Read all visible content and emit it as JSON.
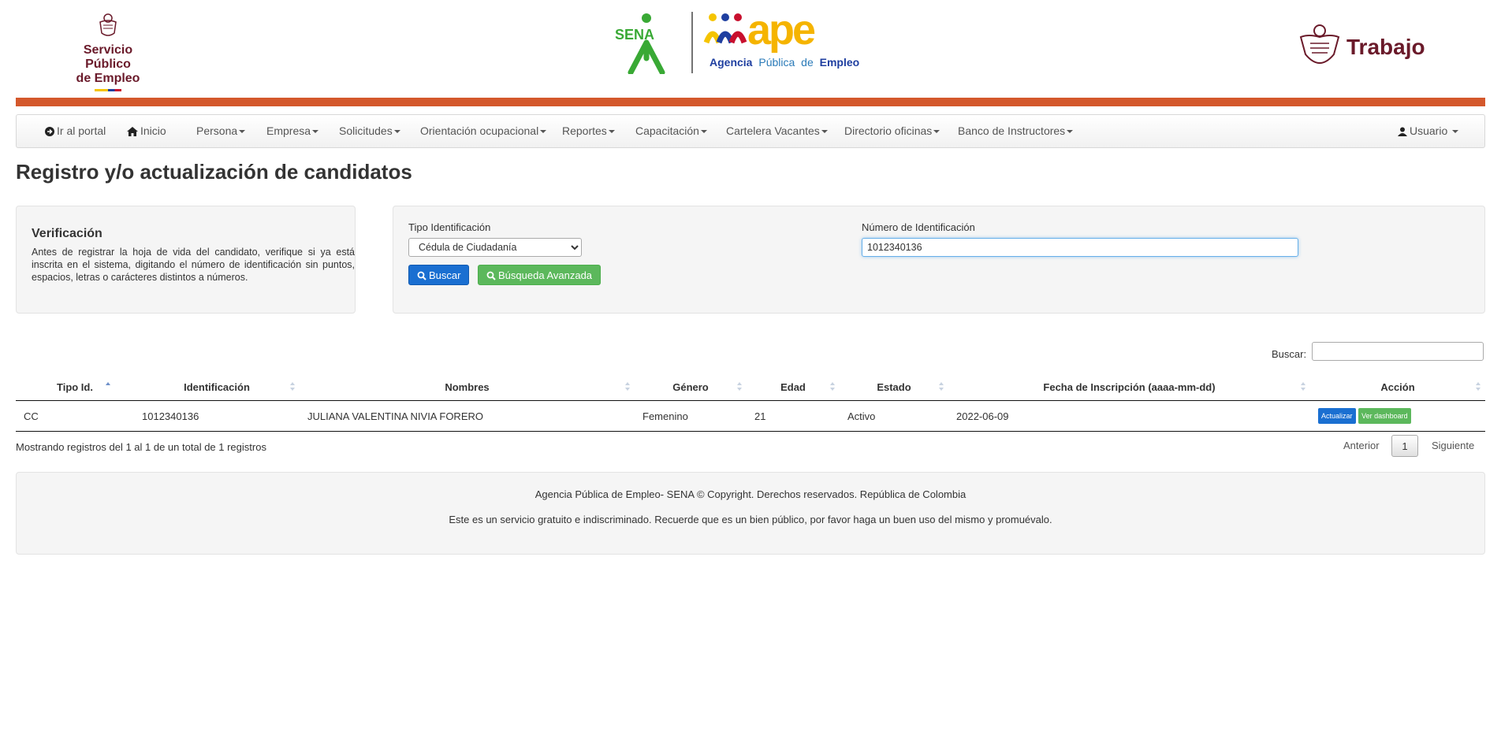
{
  "header": {
    "spe_logo": {
      "line1": "Servicio Público",
      "line2": "de Empleo"
    },
    "sena_label": "SENA",
    "ape_label": "ape",
    "ape_sub": {
      "a": "Agencia",
      "b": "Pública",
      "c": "de",
      "d": "Empleo"
    },
    "trabajo_label": "Trabajo",
    "accent_color": "#d4582c"
  },
  "nav": {
    "portal": "Ir al portal",
    "inicio": "Inicio",
    "items": [
      "Persona",
      "Empresa",
      "Solicitudes",
      "Orientación ocupacional",
      "Reportes",
      "Capacitación",
      "Cartelera Vacantes",
      "Directorio oficinas",
      "Banco de Instructores"
    ],
    "user": "Usuario"
  },
  "page_title": "Registro y/o actualización de candidatos",
  "verification": {
    "title": "Verificación",
    "text": "Antes de registrar la hoja de vida del candidato, verifique si ya está inscrita en el sistema, digitando el número de identificación sin puntos, espacios, letras o carácteres distintos a números."
  },
  "form": {
    "tipo_label": "Tipo Identificación",
    "tipo_value": "Cédula de Ciudadanía",
    "numero_label": "Número de Identificación",
    "numero_value": "1012340136",
    "buscar": "Buscar",
    "avanzada": "Búsqueda Avanzada"
  },
  "table": {
    "search_label": "Buscar:",
    "headers": [
      "Tipo Id.",
      "Identificación",
      "Nombres",
      "Género",
      "Edad",
      "Estado",
      "Fecha de Inscripción (aaaa-mm-dd)",
      "Acción"
    ],
    "rows": [
      {
        "tipo": "CC",
        "id": "1012340136",
        "nombres": "JULIANA VALENTINA NIVIA FORERO",
        "genero": "Femenino",
        "edad": "21",
        "estado": "Activo",
        "fecha": "2022-06-09",
        "actualizar": "Actualizar",
        "dashboard": "Ver dashboard"
      }
    ],
    "info": "Mostrando registros del 1 al 1 de un total de 1 registros",
    "prev": "Anterior",
    "page": "1",
    "next": "Siguiente"
  },
  "footer": {
    "line1": "Agencia Pública de Empleo- SENA © Copyright. Derechos reservados. República de Colombia",
    "line2": "Este es un servicio gratuito e indiscriminado. Recuerde que es un bien público, por favor haga un buen uso del mismo y promuévalo."
  }
}
